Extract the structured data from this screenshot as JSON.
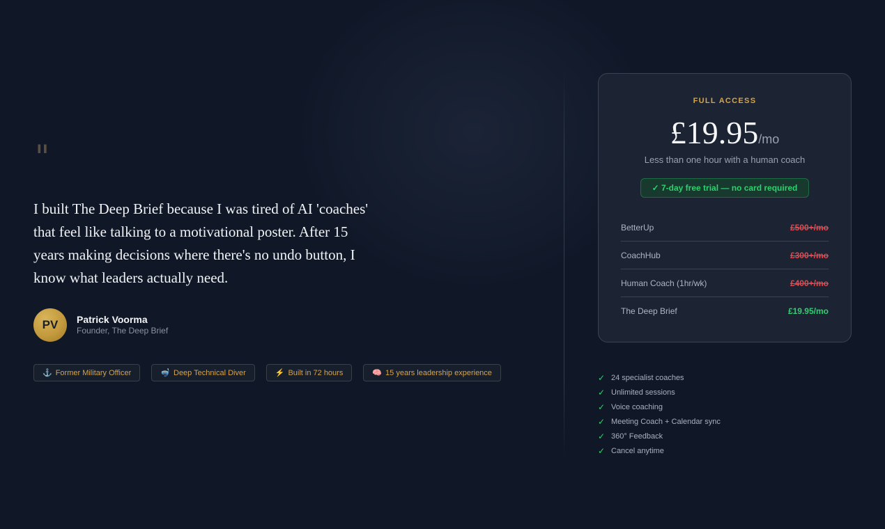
{
  "testimonial": {
    "quote_mark": "\"",
    "text": "I built The Deep Brief because I was tired of AI 'coaches' that feel like talking to a motivational poster. After 15 years making decisions where there's no undo button, I know what leaders actually need.",
    "author": {
      "initials": "PV",
      "name": "Patrick Voorma",
      "role": "Founder, The Deep Brief"
    }
  },
  "badges": [
    {
      "icon": "anchor-icon",
      "glyph": "⚓",
      "label": "Former Military Officer"
    },
    {
      "icon": "diving-mask-icon",
      "glyph": "🤿",
      "label": "Deep Technical Diver"
    },
    {
      "icon": "lightning-icon",
      "glyph": "⚡",
      "label": "Built in 72 hours"
    },
    {
      "icon": "brain-icon",
      "glyph": "🧠",
      "label": "15 years leadership experience"
    }
  ],
  "pricing": {
    "plan_label": "FULL ACCESS",
    "price": "£19.95",
    "period": "/mo",
    "note": "Less than one hour with a human coach",
    "trial": "✓ 7-day free trial — no card required",
    "comparison": [
      {
        "name": "BetterUp",
        "price": "£500+/mo"
      },
      {
        "name": "CoachHub",
        "price": "£300+/mo"
      },
      {
        "name": "Human Coach (1hr/wk)",
        "price": "£400+/mo"
      },
      {
        "name": "The Deep Brief",
        "price": "£19.95/mo"
      }
    ]
  },
  "features": {
    "check": "✓",
    "items": [
      "24 specialist coaches",
      "Unlimited sessions",
      "Voice coaching",
      "Meeting Coach + Calendar sync",
      "360° Feedback",
      "Cancel anytime"
    ]
  },
  "colors": {
    "background": "#101828",
    "card": "#1c2433",
    "gold_accent": "#d6a44a",
    "green": "#2fd06e",
    "red": "#e5484d"
  }
}
